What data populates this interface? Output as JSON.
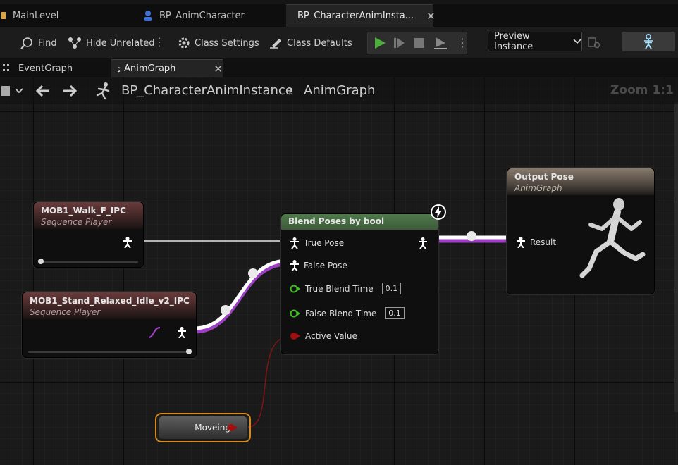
{
  "tabs": {
    "main_level": "MainLevel",
    "anim_character": "BP_AnimCharacter",
    "anim_instance": "BP_CharacterAnimInsta..."
  },
  "toolbar": {
    "find": "Find",
    "hide_unrelated": "Hide Unrelated",
    "class_settings": "Class Settings",
    "class_defaults": "Class Defaults",
    "preview_instance": "Preview Instance"
  },
  "graph_tabs": {
    "event_graph": "EventGraph",
    "anim_graph": "AnimGraph"
  },
  "breadcrumb": {
    "blueprint": "BP_CharacterAnimInstance",
    "graph": "AnimGraph",
    "zoom": "Zoom 1:1"
  },
  "nodes": {
    "walk": {
      "title": "MOB1_Walk_F_IPC",
      "subtitle": "Sequence Player"
    },
    "idle": {
      "title": "MOB1_Stand_Relaxed_Idle_v2_IPC",
      "subtitle": "Sequence Player"
    },
    "blend": {
      "title": "Blend Poses by bool",
      "true_pose": "True Pose",
      "false_pose": "False Pose",
      "true_blend_time": "True Blend Time",
      "true_blend_value": "0.1",
      "false_blend_time": "False Blend Time",
      "false_blend_value": "0.1",
      "active_value": "Active Value"
    },
    "output": {
      "title": "Output Pose",
      "subtitle": "AnimGraph",
      "result": "Result"
    },
    "variable": {
      "label": "Moveing"
    }
  },
  "colors": {
    "pose_wire": "#ffffff",
    "anim_wire": "#9d3fc2",
    "bool_pin": "#a30d0d",
    "float_pin": "#3fbf24",
    "variable_outline": "#d8891c",
    "play_green": "#4caf3c"
  },
  "icons": [
    "blueprint-icon",
    "character-icon",
    "anim-blueprint-icon",
    "find-icon",
    "hide-unrelated-icon",
    "class-settings-icon",
    "class-defaults-icon",
    "play-icon",
    "step-icon",
    "stop-icon",
    "eject-icon",
    "chevron-down-icon",
    "skeleton-icon",
    "event-graph-icon",
    "anim-graph-icon",
    "bookmark-icon",
    "back-arrow-icon",
    "forward-arrow-icon",
    "running-figure-icon",
    "pose-pin-icon",
    "fast-path-icon"
  ]
}
